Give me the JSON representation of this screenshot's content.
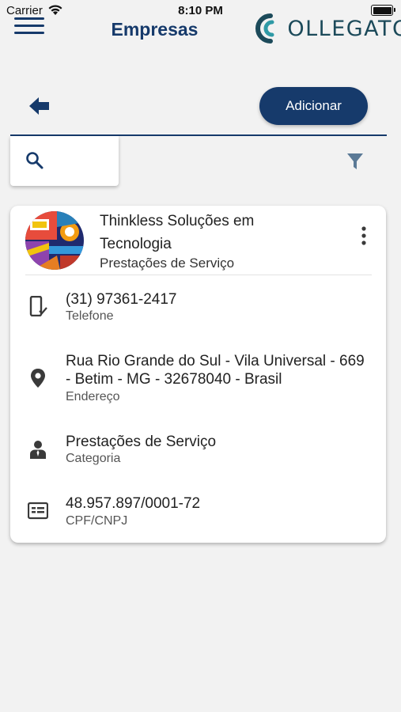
{
  "status_bar": {
    "carrier": "Carrier",
    "time": "8:10 PM"
  },
  "header": {
    "title": "Empresas",
    "logo_text": "COLLEGATO",
    "brand_color": "#163a6b"
  },
  "toolbar": {
    "add_label": "Adicionar"
  },
  "search": {
    "placeholder": ""
  },
  "company": {
    "name": "Thinkless Soluções em Tecnologia",
    "category": "Prestações de Serviço",
    "fields": [
      {
        "icon": "phone-check-icon",
        "value": "(31) 97361-2417",
        "label": "Telefone"
      },
      {
        "icon": "location-pin-icon",
        "value": "Rua Rio Grande do Sul - Vila Universal - 669 - Betim - MG - 32678040 - Brasil",
        "label": "Endereço"
      },
      {
        "icon": "person-tie-icon",
        "value": "Prestações de Serviço",
        "label": "Categoria"
      },
      {
        "icon": "id-card-icon",
        "value": "48.957.897/0001-72",
        "label": "CPF/CNPJ"
      }
    ]
  }
}
